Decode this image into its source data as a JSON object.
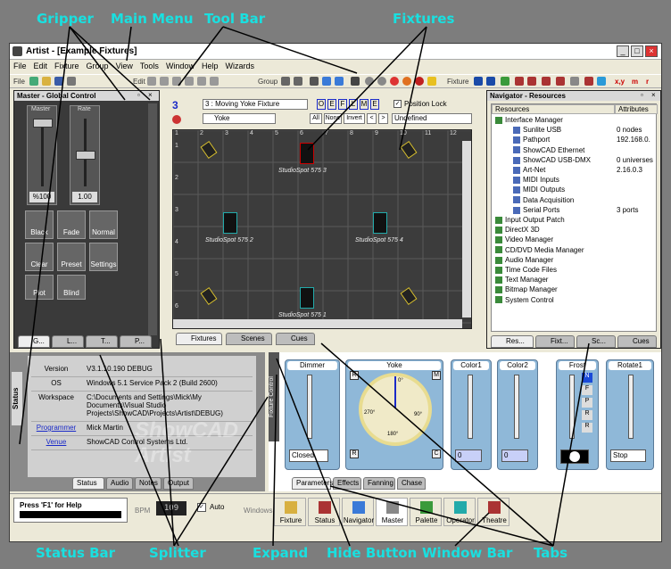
{
  "callouts": {
    "gripper": "Gripper",
    "main_menu": "Main Menu",
    "tool_bar": "Tool Bar",
    "fixtures": "Fixtures",
    "status_bar": "Status Bar",
    "splitter": "Splitter",
    "expand": "Expand",
    "hide_button": "Hide Button",
    "window_bar": "Window Bar",
    "tabs": "Tabs"
  },
  "window": {
    "title": "Artist - [Example Fixtures]",
    "min": "_",
    "max": "□",
    "close": "×"
  },
  "menu": [
    "File",
    "Edit",
    "Fixture",
    "Group",
    "View",
    "Tools",
    "Window",
    "Help",
    "Wizards"
  ],
  "toolbar": {
    "file": "File",
    "edit": "Edit",
    "group": "Group",
    "fixture": "Fixture",
    "xy": "x,y",
    "m": "m",
    "r": "r"
  },
  "master": {
    "title": "Master - Global Control",
    "master_label": "Master",
    "rate_label": "Rate",
    "master_value": "%100",
    "rate_value": "1.00",
    "buttons": [
      "Black",
      "Fade",
      "Normal",
      "Clear",
      "Preset",
      "Settings",
      "Plot",
      "Blind"
    ],
    "tabs": [
      "G...",
      "L...",
      "T...",
      "P..."
    ]
  },
  "center": {
    "group_number": "3",
    "fixture_select": "3 : Moving Yoke Fixture",
    "yoke_select": "Yoke",
    "letters": [
      "O",
      "E",
      "F",
      "L",
      "M",
      "E"
    ],
    "position_lock": "Position Lock",
    "sel_buttons": [
      "All",
      "None",
      "Invert",
      "<",
      ">"
    ],
    "undefined": "Undefined",
    "columns": [
      "1",
      "2",
      "3",
      "4",
      "5",
      "6",
      "7",
      "8",
      "9",
      "10",
      "11",
      "12"
    ],
    "rows": [
      "1",
      "2",
      "3",
      "4",
      "5",
      "6"
    ],
    "fixtures": [
      {
        "label": "StudioSpot 575 3"
      },
      {
        "label": "StudioSpot 575 2"
      },
      {
        "label": "StudioSpot 575 4"
      },
      {
        "label": "StudioSpot 575 1"
      }
    ],
    "tabs": [
      "Fixtures",
      "Scenes",
      "Cues"
    ]
  },
  "navigator": {
    "title": "Navigator - Resources",
    "col1": "Resources",
    "col2": "Attributes",
    "items": [
      {
        "name": "Interface Manager",
        "attr": ""
      },
      {
        "name": "Sunlite USB",
        "attr": "0 nodes"
      },
      {
        "name": "Pathport",
        "attr": "192.168.0."
      },
      {
        "name": "ShowCAD Ethernet",
        "attr": ""
      },
      {
        "name": "ShowCAD USB-DMX",
        "attr": "0 universes"
      },
      {
        "name": "Art-Net",
        "attr": "2.16.0.3"
      },
      {
        "name": "MIDI Inputs",
        "attr": ""
      },
      {
        "name": "MIDI Outputs",
        "attr": ""
      },
      {
        "name": "Data Acquisition",
        "attr": ""
      },
      {
        "name": "Serial Ports",
        "attr": "3 ports"
      },
      {
        "name": "Input Output Patch",
        "attr": ""
      },
      {
        "name": "DirectX 3D",
        "attr": ""
      },
      {
        "name": "Video Manager",
        "attr": ""
      },
      {
        "name": "CD/DVD Media Manager",
        "attr": ""
      },
      {
        "name": "Audio Manager",
        "attr": ""
      },
      {
        "name": "Time Code Files",
        "attr": ""
      },
      {
        "name": "Text Manager",
        "attr": ""
      },
      {
        "name": "Bitmap Manager",
        "attr": ""
      },
      {
        "name": "System Control",
        "attr": ""
      }
    ],
    "tabs": [
      "Res...",
      "Fixt...",
      "Sc...",
      "Cues"
    ]
  },
  "status": {
    "title": "Status",
    "rows": [
      {
        "key": "Version",
        "value": "V3.1.10.190 DEBUG"
      },
      {
        "key": "OS",
        "value": "Windows 5.1 Service Pack 2 (Build 2600)"
      },
      {
        "key": "Workspace",
        "value": "C:\\Documents and Settings\\Mick\\My Documents\\Visual Studio Projects\\ShowCAD\\Projects\\Artist\\DEBUG)"
      },
      {
        "key": "Programmer",
        "value": "Mick Martin"
      },
      {
        "key": "Venue",
        "value": "ShowCAD Control Systems Ltd."
      }
    ],
    "tabs": [
      "Status",
      "Audio",
      "Notes",
      "Output"
    ],
    "watermark": "ShowCAD Artist"
  },
  "fixture_control": {
    "side_title": "Fixture Control",
    "dimmer": "Dimmer",
    "dimmer_value": "Closed",
    "yoke": "Yoke",
    "yoke_buttons": [
      "R",
      "M",
      "R",
      "C"
    ],
    "angles": [
      "0°",
      "90°",
      "180°",
      "270°"
    ],
    "color1": "Color1",
    "color1_value": "0",
    "color2": "Color2",
    "color2_value": "0",
    "frost": "Frost",
    "frost_buttons": [
      "N",
      "F",
      "P",
      "R",
      "R"
    ],
    "rotate": "Rotate1",
    "rotate_value": "Stop",
    "tabs": [
      "Parameters",
      "Effects",
      "Fanning",
      "Chase"
    ]
  },
  "bottom": {
    "help": "Press 'F1' for Help",
    "bpm": "BPM",
    "bpm_value": "109",
    "auto": "Auto",
    "windows": "Windows",
    "window_buttons": [
      "Fixture",
      "Status",
      "Navigator",
      "Master",
      "Palette",
      "Operator",
      "Theatre"
    ]
  }
}
